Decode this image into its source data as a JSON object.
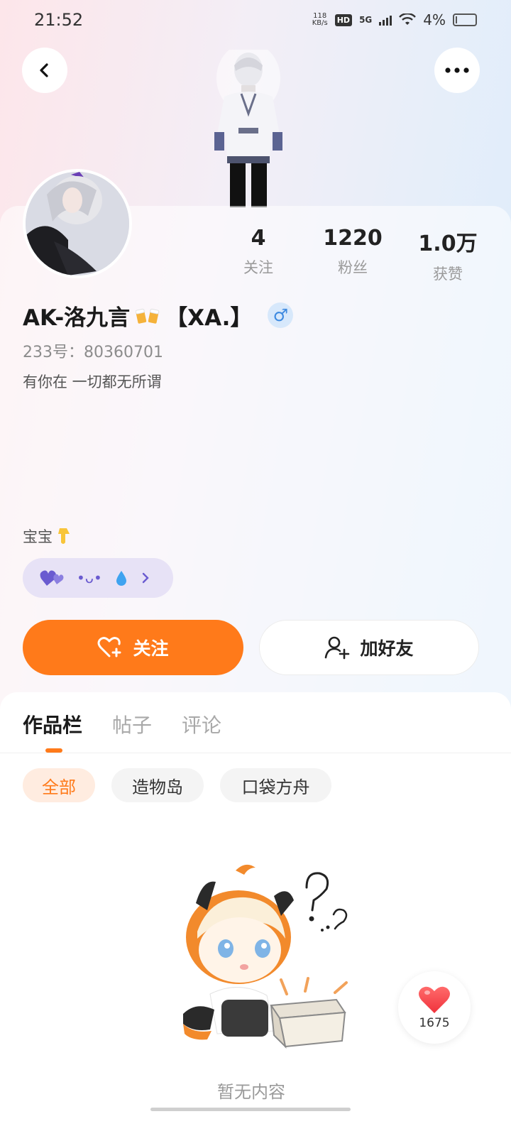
{
  "status_bar": {
    "time": "21:52",
    "net_speed_value": "118",
    "net_speed_unit": "KB/s",
    "hd": "HD",
    "network": "5G",
    "battery": "4%"
  },
  "profile": {
    "stats": [
      {
        "value": "4",
        "label": "关注"
      },
      {
        "value": "1220",
        "label": "粉丝"
      },
      {
        "value": "1.0万",
        "label": "获赞"
      }
    ],
    "username": "AK-洛九言",
    "username_suffix": "【XA.】",
    "gender_symbol": "♂",
    "uid": "233号：80360701",
    "bio": "有你在 一切都无所谓",
    "tagline": "宝宝",
    "pill_text": "•ᴗ•"
  },
  "actions": {
    "follow": "关注",
    "add_friend": "加好友"
  },
  "tabs": [
    {
      "label": "作品栏",
      "active": true
    },
    {
      "label": "帖子",
      "active": false
    },
    {
      "label": "评论",
      "active": false
    }
  ],
  "filters": [
    {
      "label": "全部",
      "active": true
    },
    {
      "label": "造物岛",
      "active": false
    },
    {
      "label": "口袋方舟",
      "active": false
    }
  ],
  "empty_state": "暂无内容",
  "like_float": {
    "count": "1675"
  },
  "colors": {
    "accent": "#ff7a1a",
    "pill_bg": "#e7e2f6",
    "pill_fg": "#6a5bd0",
    "gender_fg": "#3e8ae0"
  }
}
